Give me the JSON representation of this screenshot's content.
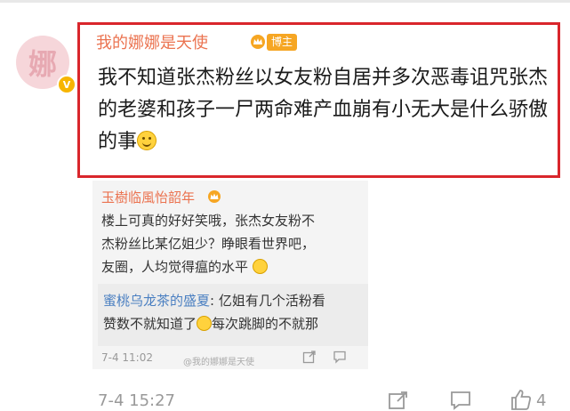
{
  "post": {
    "avatar_char": "娜",
    "verified_mark": "V",
    "username": "我的娜娜是天使",
    "badge": "博主",
    "text": "我不知道张杰粉丝以女友粉自居并多次恶毒诅咒张杰的老婆和孩子一尸两命难产血崩有小无大是什么骄傲的事",
    "time": "7-4 15:27",
    "like_count": "4",
    "accent_color": "#eb7350",
    "highlight_border_color": "#d9262c"
  },
  "reply": {
    "username": "玉樹临風怡韶年",
    "lines": [
      "楼上可真的好好笑哦，张杰女友粉不",
      "杰粉丝比某亿姐少？睁眼看世界吧，",
      "友圈，人均觉得瘟的水平"
    ],
    "nested": {
      "username": "蜜桃乌龙茶的盛夏",
      "line1": "亿姐有几个活粉看",
      "line2_a": "赞数不就知道了",
      "line2_b": "每次跳脚的不就那"
    },
    "time": "7-4 11:02",
    "watermark": "@我的娜娜是天使"
  },
  "icons": [
    "crown-icon",
    "smile-icon",
    "share-icon",
    "comment-icon",
    "like-icon"
  ]
}
